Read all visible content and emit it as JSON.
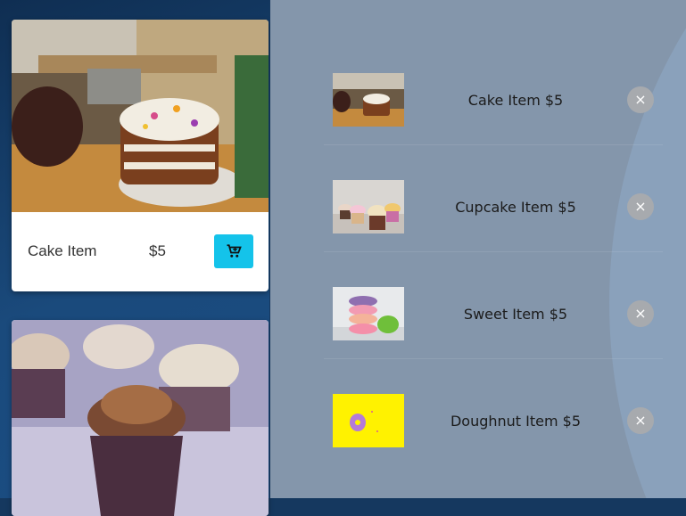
{
  "products": [
    {
      "name": "Cake Item",
      "price": "$5",
      "image": "cake-photo"
    },
    {
      "name": "",
      "price": "",
      "image": "cupcake-photo"
    }
  ],
  "cart": {
    "items": [
      {
        "label": "Cake Item $5",
        "image": "cake-thumbnail"
      },
      {
        "label": "Cupcake Item $5",
        "image": "cupcake-thumbnail"
      },
      {
        "label": "Sweet Item $5",
        "image": "macaron-thumbnail"
      },
      {
        "label": "Doughnut Item $5",
        "image": "doughnut-thumbnail"
      }
    ],
    "remove_symbol": "×"
  },
  "colors": {
    "accent": "#14c3ea",
    "overlay": "#8496ab",
    "background": "#15385f"
  }
}
